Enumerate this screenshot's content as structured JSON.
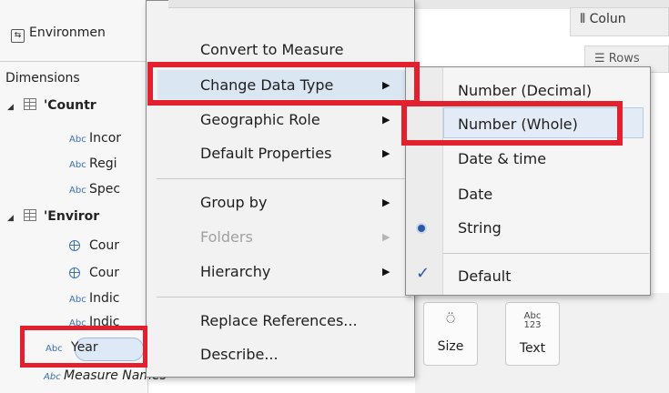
{
  "data_pane": {
    "source_name": "Environmen",
    "dimensions_header": "Dimensions",
    "rows": [
      {
        "kind": "table",
        "label": "'Countr"
      },
      {
        "kind": "field",
        "type_badge": "Abc",
        "label": "Incor"
      },
      {
        "kind": "field",
        "type_badge": "Abc",
        "label": "Regi"
      },
      {
        "kind": "field",
        "type_badge": "Abc",
        "label": "Spec"
      },
      {
        "kind": "table",
        "label": "'Enviror"
      },
      {
        "kind": "geo",
        "label": "Cour"
      },
      {
        "kind": "geo",
        "label": "Cour"
      },
      {
        "kind": "field",
        "type_badge": "Abc",
        "label": "Indic"
      },
      {
        "kind": "field",
        "type_badge": "Abc",
        "label": "Indic"
      },
      {
        "kind": "field",
        "type_badge": "Abc",
        "label": "Year",
        "selected": true
      },
      {
        "kind": "field",
        "type_badge": "Abc",
        "label": "Measure Names"
      }
    ]
  },
  "context_menu": {
    "items": [
      {
        "label": "Convert to Measure"
      },
      {
        "label": "Change Data Type",
        "submenu": true,
        "active": true
      },
      {
        "label": "Geographic Role",
        "submenu": true
      },
      {
        "label": "Default Properties",
        "submenu": true
      },
      {
        "label": "Group by",
        "submenu": true
      },
      {
        "label": "Folders",
        "submenu": true,
        "disabled": true
      },
      {
        "label": "Hierarchy",
        "submenu": true
      },
      {
        "label": "Replace References..."
      },
      {
        "label": "Describe..."
      }
    ]
  },
  "data_type_submenu": {
    "items": [
      {
        "label": "Number (Decimal)"
      },
      {
        "label": "Number (Whole)",
        "hovered": true
      },
      {
        "label": "Date & time"
      },
      {
        "label": "Date"
      },
      {
        "label": "String",
        "radio_selected": true
      },
      {
        "label": "Default",
        "checked": true
      }
    ]
  },
  "shelves": {
    "columns_label": "Colun",
    "rows_label": "Rows"
  },
  "marks": {
    "size_label": "Size",
    "text_label": "Text",
    "text_icon_line1": "Abc",
    "text_icon_line2": "123"
  },
  "colors": {
    "annotation_red": "#e3212e",
    "accent_blue": "#2b58a8"
  }
}
